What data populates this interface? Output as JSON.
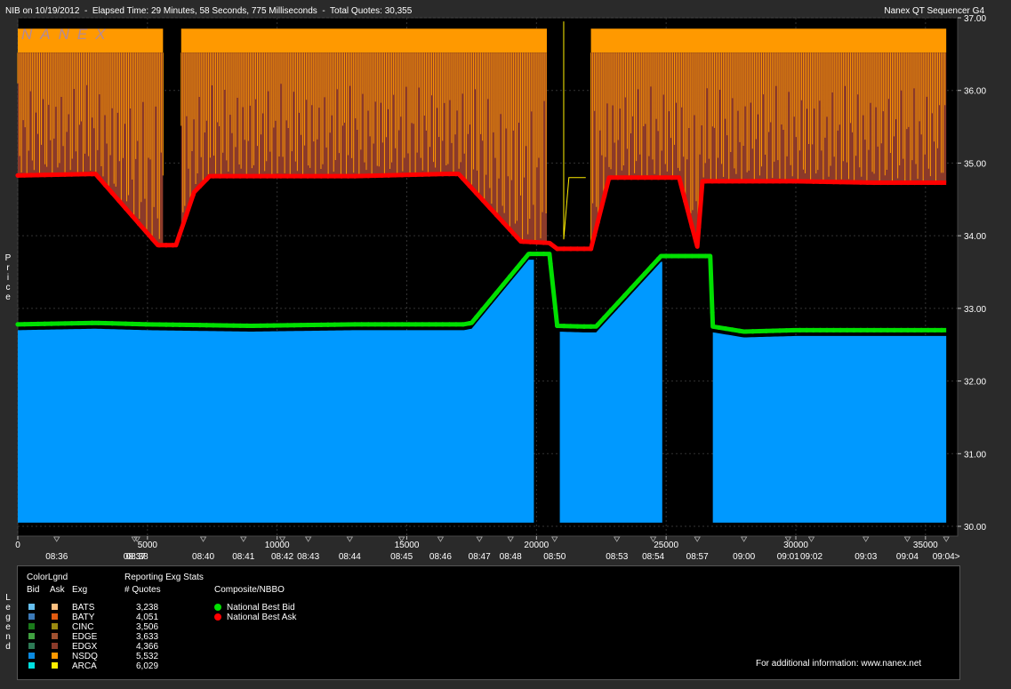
{
  "header": {
    "left": "NIB on 10/19/2012  -  Elapsed Time: 29 Minutes, 58 Seconds, 775 Milliseconds  -  Total Quotes: 30,355",
    "right": "Nanex QT Sequencer G4"
  },
  "watermark": "NANEX",
  "ylabel": "Price",
  "legend_side_label": "Legend",
  "colors": {
    "background": "#000000",
    "ask_fill_orange": "#ff9900",
    "ask_fill_brown": "#8b3a2a",
    "bid_fill_blue": "#0099ff",
    "nbb_green": "#00e000",
    "nbo_red": "#ff0000"
  },
  "chart_data": {
    "type": "area",
    "title": "",
    "xlabel": "",
    "ylabel": "Price",
    "xlim": [
      0,
      36000
    ],
    "ylim": [
      30.0,
      37.0
    ],
    "y_ticks": [
      "30.00",
      "31.00",
      "32.00",
      "33.00",
      "34.00",
      "35.00",
      "36.00",
      "37.00"
    ],
    "x_ticks": [
      "0",
      "5000",
      "10000",
      "15000",
      "20000",
      "25000",
      "30000",
      "35000"
    ],
    "time_labels": [
      {
        "x": 1500,
        "label": "08:36"
      },
      {
        "x": 4500,
        "label": "08:37"
      },
      {
        "x": 4600,
        "label": "08:38"
      },
      {
        "x": 7150,
        "label": "08:40"
      },
      {
        "x": 8700,
        "label": "08:41"
      },
      {
        "x": 10200,
        "label": "08:42"
      },
      {
        "x": 11200,
        "label": "08:43"
      },
      {
        "x": 12800,
        "label": "08:44"
      },
      {
        "x": 14800,
        "label": "08:45"
      },
      {
        "x": 16300,
        "label": "08:46"
      },
      {
        "x": 17800,
        "label": "08:47"
      },
      {
        "x": 19000,
        "label": "08:48"
      },
      {
        "x": 20700,
        "label": "08:50"
      },
      {
        "x": 23100,
        "label": "08:53"
      },
      {
        "x": 24500,
        "label": "08:54"
      },
      {
        "x": 26200,
        "label": "08:57"
      },
      {
        "x": 28000,
        "label": "09:00"
      },
      {
        "x": 29700,
        "label": "09:01"
      },
      {
        "x": 30600,
        "label": "09:02"
      },
      {
        "x": 32700,
        "label": "09:03"
      },
      {
        "x": 34300,
        "label": "09:04"
      },
      {
        "x": 35800,
        "label": "09:04>"
      }
    ],
    "series": [
      {
        "name": "National Best Bid",
        "x": [
          0,
          1500,
          3000,
          5000,
          7000,
          9000,
          11000,
          13000,
          15000,
          17200,
          17500,
          19700,
          20500,
          20800,
          21800,
          22300,
          24800,
          26700,
          26800,
          28000,
          30000,
          32000,
          34000,
          35800
        ],
        "y": [
          32.78,
          32.79,
          32.8,
          32.78,
          32.77,
          32.76,
          32.77,
          32.78,
          32.78,
          32.78,
          32.8,
          33.75,
          33.75,
          32.76,
          32.75,
          32.75,
          33.72,
          33.72,
          32.75,
          32.68,
          32.7,
          32.7,
          32.7,
          32.7
        ]
      },
      {
        "name": "National Best Ask",
        "x": [
          0,
          3000,
          5400,
          6100,
          6800,
          7400,
          10000,
          13000,
          16500,
          17000,
          19400,
          20500,
          20800,
          22100,
          22800,
          24900,
          25500,
          26200,
          26400,
          27500,
          30000,
          33000,
          35800
        ],
        "y": [
          34.83,
          34.85,
          33.87,
          33.87,
          34.6,
          34.82,
          34.82,
          34.82,
          34.85,
          34.85,
          33.92,
          33.9,
          33.82,
          33.82,
          34.8,
          34.8,
          34.8,
          33.85,
          34.75,
          34.75,
          34.75,
          34.73,
          34.73
        ]
      }
    ]
  },
  "legend": {
    "colorlgnd": "ColorLgnd",
    "bid": "Bid",
    "ask": "Ask",
    "exg": "Exg",
    "reporting": "Reporting Exg Stats",
    "quotes_header": "# Quotes",
    "composite": "Composite/NBBO",
    "rows": [
      {
        "exg": "BATS",
        "quotes": "3,238",
        "bid_color": "#66c0f0",
        "ask_color": "#ffc080"
      },
      {
        "exg": "BATY",
        "quotes": "4,051",
        "bid_color": "#3c7ab8",
        "ask_color": "#e05a10"
      },
      {
        "exg": "CINC",
        "quotes": "3,506",
        "bid_color": "#1a7a1a",
        "ask_color": "#9a8a10"
      },
      {
        "exg": "EDGE",
        "quotes": "3,633",
        "bid_color": "#40a040",
        "ask_color": "#a05030"
      },
      {
        "exg": "EDGX",
        "quotes": "4,366",
        "bid_color": "#2d7a55",
        "ask_color": "#8b3a2a"
      },
      {
        "exg": "NSDQ",
        "quotes": "5,532",
        "bid_color": "#0b8ae0",
        "ask_color": "#ff9900"
      },
      {
        "exg": "ARCA",
        "quotes": "6,029",
        "bid_color": "#00e0e0",
        "ask_color": "#ffee00"
      }
    ],
    "nbbo": [
      {
        "label": "National Best Bid",
        "color": "#00e000"
      },
      {
        "label": "National Best Ask",
        "color": "#ff0000"
      }
    ],
    "footer": "For additional information: www.nanex.net"
  }
}
